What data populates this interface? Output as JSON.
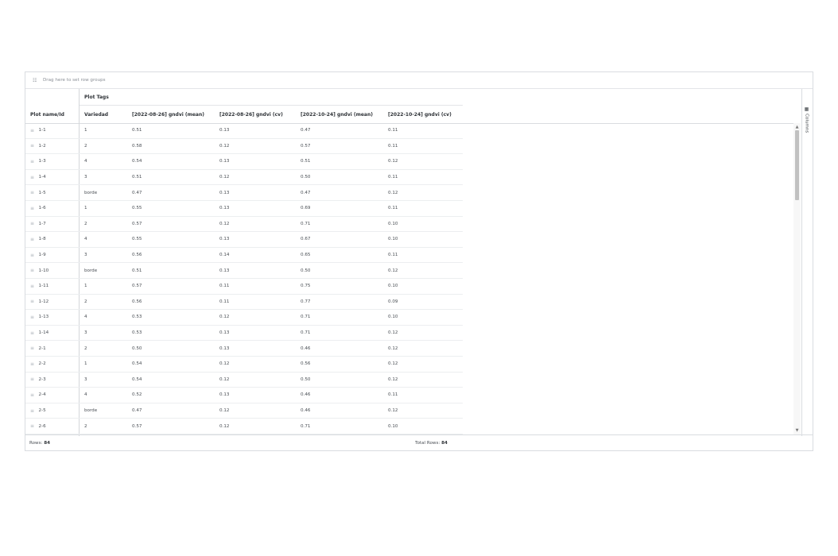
{
  "rowgroup": {
    "text": "Drag here to set row groups"
  },
  "header": {
    "group_label": "Plot Tags",
    "columns": [
      "Plot name/Id",
      "Variedad",
      "[2022-08-26] gndvi (mean)",
      "[2022-08-26] gndvi (cv)",
      "[2022-10-24] gndvi (mean)",
      "[2022-10-24] gndvi (cv)"
    ]
  },
  "rows": [
    [
      "1-1",
      "1",
      "0.51",
      "0.13",
      "0.47",
      "0.11"
    ],
    [
      "1-2",
      "2",
      "0.58",
      "0.12",
      "0.57",
      "0.11"
    ],
    [
      "1-3",
      "4",
      "0.54",
      "0.13",
      "0.51",
      "0.12"
    ],
    [
      "1-4",
      "3",
      "0.51",
      "0.12",
      "0.50",
      "0.11"
    ],
    [
      "1-5",
      "borde",
      "0.47",
      "0.13",
      "0.47",
      "0.12"
    ],
    [
      "1-6",
      "1",
      "0.55",
      "0.13",
      "0.69",
      "0.11"
    ],
    [
      "1-7",
      "2",
      "0.57",
      "0.12",
      "0.71",
      "0.10"
    ],
    [
      "1-8",
      "4",
      "0.55",
      "0.13",
      "0.67",
      "0.10"
    ],
    [
      "1-9",
      "3",
      "0.56",
      "0.14",
      "0.65",
      "0.11"
    ],
    [
      "1-10",
      "borde",
      "0.51",
      "0.13",
      "0.50",
      "0.12"
    ],
    [
      "1-11",
      "1",
      "0.57",
      "0.11",
      "0.75",
      "0.10"
    ],
    [
      "1-12",
      "2",
      "0.56",
      "0.11",
      "0.77",
      "0.09"
    ],
    [
      "1-13",
      "4",
      "0.53",
      "0.12",
      "0.71",
      "0.10"
    ],
    [
      "1-14",
      "3",
      "0.53",
      "0.13",
      "0.71",
      "0.12"
    ],
    [
      "2-1",
      "2",
      "0.50",
      "0.13",
      "0.46",
      "0.12"
    ],
    [
      "2-2",
      "1",
      "0.54",
      "0.12",
      "0.56",
      "0.12"
    ],
    [
      "2-3",
      "3",
      "0.54",
      "0.12",
      "0.50",
      "0.12"
    ],
    [
      "2-4",
      "4",
      "0.52",
      "0.13",
      "0.46",
      "0.11"
    ],
    [
      "2-5",
      "borde",
      "0.47",
      "0.12",
      "0.46",
      "0.12"
    ],
    [
      "2-6",
      "2",
      "0.57",
      "0.12",
      "0.71",
      "0.10"
    ]
  ],
  "side_panel": {
    "columns_label": "Columns"
  },
  "footer": {
    "rows_label": "Rows:",
    "rows_value": "84",
    "total_label": "Total Rows:",
    "total_value": "84"
  },
  "icons": {
    "rowgroup": "row-group-icon",
    "drag": "drag-handle-icon",
    "columns": "columns-icon"
  }
}
